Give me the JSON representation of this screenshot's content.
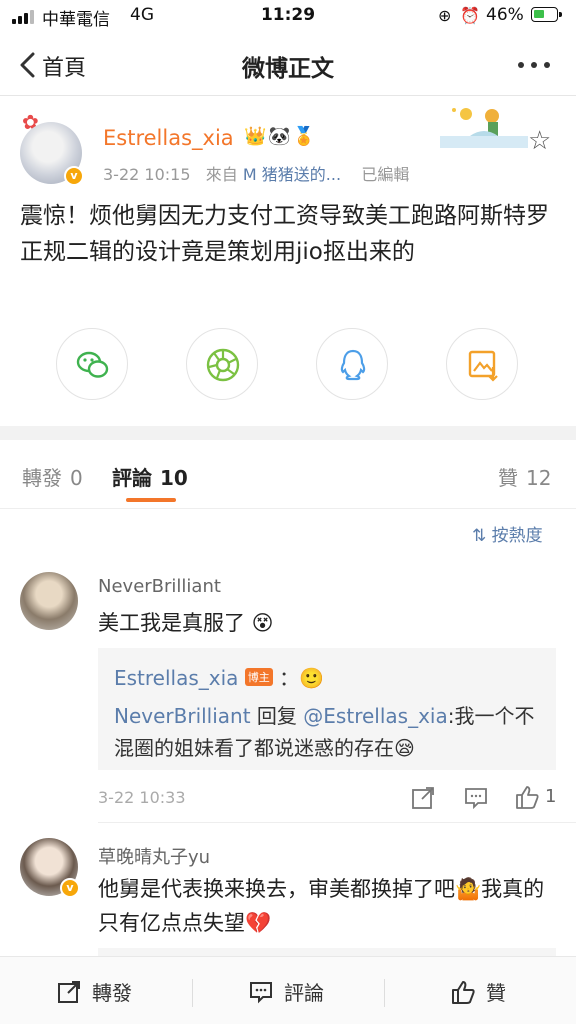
{
  "status_bar": {
    "carrier": "中華電信",
    "network": "4G",
    "time": "11:29",
    "battery_percent": "46%",
    "battery_level": 0.46
  },
  "nav": {
    "back_label": "首頁",
    "title": "微博正文"
  },
  "post": {
    "username": "Estrellas_xia",
    "date": "3-22 10:15",
    "source_prefix": "來自",
    "source": "M 猪猪送的...",
    "edited": "已編輯",
    "text": "震惊！烦他舅因无力支付工资导致美工跑路阿斯特罗正规二辑的设计竟是策划用jio抠出来的"
  },
  "share_icons": [
    "wechat-icon",
    "moments-icon",
    "qq-icon",
    "save-image-icon"
  ],
  "tabs": {
    "repost_label": "轉發",
    "repost_count": "0",
    "comment_label": "評論",
    "comment_count": "10",
    "like_label": "贊",
    "like_count": "12"
  },
  "sort_label": "按熱度",
  "comments": [
    {
      "name": "NeverBrilliant",
      "text": "美工我是真服了",
      "reply": {
        "author": "Estrellas_xia",
        "badge": "博主",
        "colon": "：",
        "line_name": "NeverBrilliant",
        "line_text_prefix": " 回复 ",
        "line_mention": "@Estrellas_xia",
        "line_text": ":我一个不混圈的姐妹看了都说迷惑的存在"
      },
      "date": "3-22 10:33",
      "likes": "1"
    },
    {
      "name": "草晚晴丸子yu",
      "text": "他舅是代表换来换去，审美都换掉了吧",
      "text2": "我真的只有亿点点失望"
    }
  ],
  "bottom_bar": {
    "repost": "轉發",
    "comment": "評論",
    "like": "贊"
  },
  "colors": {
    "accent": "#f3762a",
    "link": "#5b7dab",
    "verified": "#f7a70a"
  }
}
